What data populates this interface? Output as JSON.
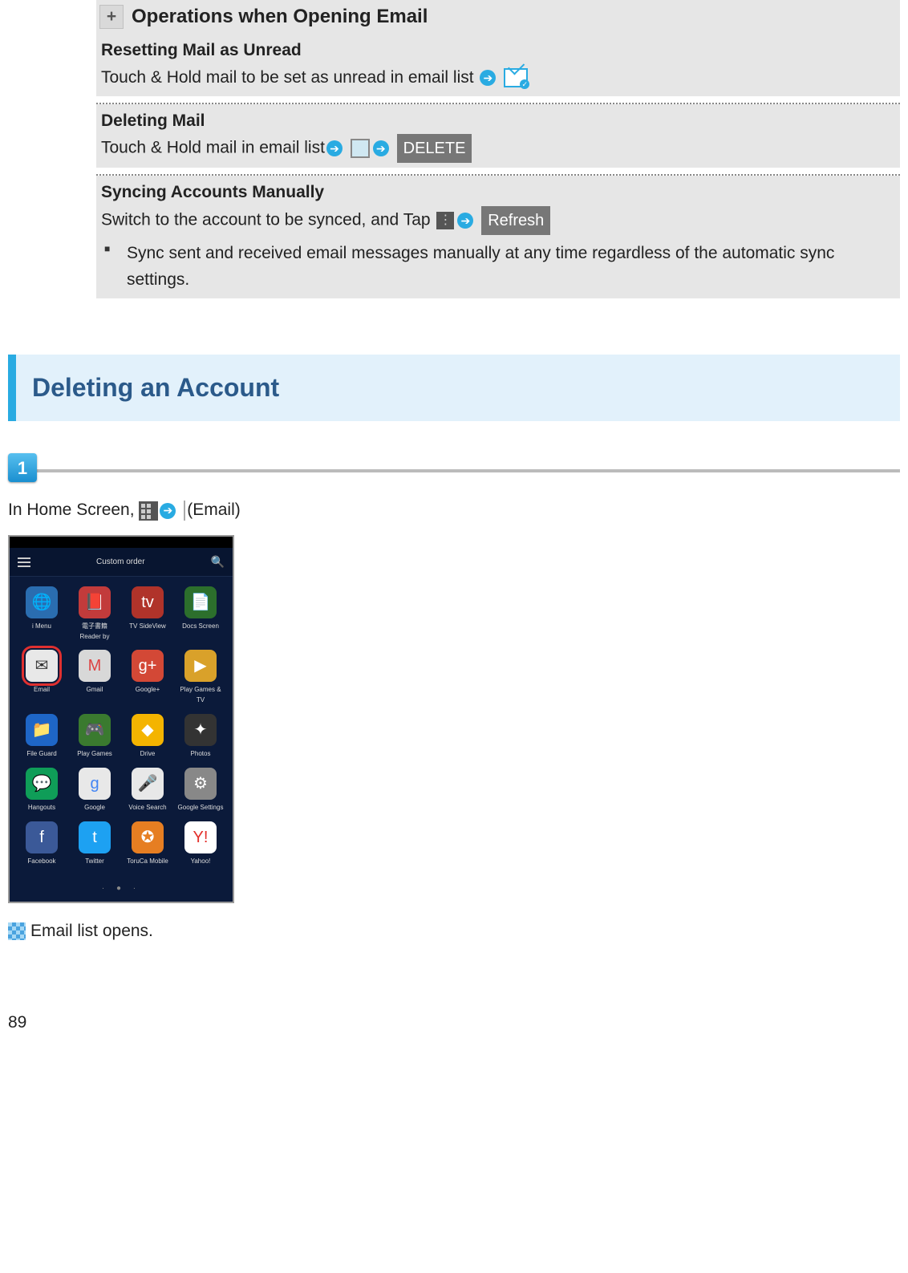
{
  "tip": {
    "title": "Operations when Opening Email",
    "blocks": [
      {
        "heading": "Resetting Mail as Unread",
        "body": "Touch & Hold mail to be set as unread in email list",
        "trail": [
          "arrow",
          "envelope-check"
        ]
      },
      {
        "heading": "Deleting Mail",
        "body": "Touch & Hold mail in email list",
        "trail": [
          "arrow",
          "checkbox",
          "arrow"
        ],
        "button": "DELETE"
      },
      {
        "heading": "Syncing Accounts Manually",
        "body": "Switch to the account to be synced, and Tap ",
        "trail": [
          "menu",
          "arrow"
        ],
        "button": "Refresh",
        "bullet": "Sync sent and received email messages manually at any time regardless of the automatic sync settings."
      }
    ]
  },
  "section": {
    "title": "Deleting an Account"
  },
  "step": {
    "number": "1",
    "prefix": "In Home Screen, ",
    "suffix": " (Email)"
  },
  "screenshot": {
    "topbar": "Custom order",
    "apps": [
      {
        "lbl": "i Menu",
        "bg": "#2a6db0",
        "glyph": "🌐"
      },
      {
        "lbl": "電子書籍 Reader by",
        "bg": "#c23b3b",
        "glyph": "📕"
      },
      {
        "lbl": "TV SideView",
        "bg": "#b0332a",
        "glyph": "tv"
      },
      {
        "lbl": "Docs Screen",
        "bg": "#2c6f2c",
        "glyph": "📄"
      },
      {
        "lbl": "Email",
        "bg": "#e8e8e8",
        "glyph": "✉",
        "highlight": true,
        "fg": "#333"
      },
      {
        "lbl": "Gmail",
        "bg": "#d8d8d8",
        "glyph": "M",
        "fg": "#d44"
      },
      {
        "lbl": "Google+",
        "bg": "#d34836",
        "glyph": "g+"
      },
      {
        "lbl": "Play Games & TV",
        "bg": "#d9a12a",
        "glyph": "▶"
      },
      {
        "lbl": "File Guard",
        "bg": "#1e66c7",
        "glyph": "📁"
      },
      {
        "lbl": "Play Games",
        "bg": "#3a7a2f",
        "glyph": "🎮"
      },
      {
        "lbl": "Drive",
        "bg": "#f4b400",
        "glyph": "◆"
      },
      {
        "lbl": "Photos",
        "bg": "#333",
        "glyph": "✦"
      },
      {
        "lbl": "Hangouts",
        "bg": "#0f9d58",
        "glyph": "💬"
      },
      {
        "lbl": "Google",
        "bg": "#e8e8e8",
        "glyph": "g",
        "fg": "#4285f4"
      },
      {
        "lbl": "Voice Search",
        "bg": "#e8e8e8",
        "glyph": "🎤",
        "fg": "#666"
      },
      {
        "lbl": "Google Settings",
        "bg": "#888",
        "glyph": "⚙"
      },
      {
        "lbl": "Facebook",
        "bg": "#3b5998",
        "glyph": "f"
      },
      {
        "lbl": "Twitter",
        "bg": "#1da1f2",
        "glyph": "t"
      },
      {
        "lbl": "ToruCa Mobile",
        "bg": "#e67e22",
        "glyph": "✪"
      },
      {
        "lbl": "Yahoo!",
        "bg": "#fff",
        "glyph": "Y!",
        "fg": "#e3302b"
      }
    ]
  },
  "result": "Email list opens.",
  "page_number": "89"
}
